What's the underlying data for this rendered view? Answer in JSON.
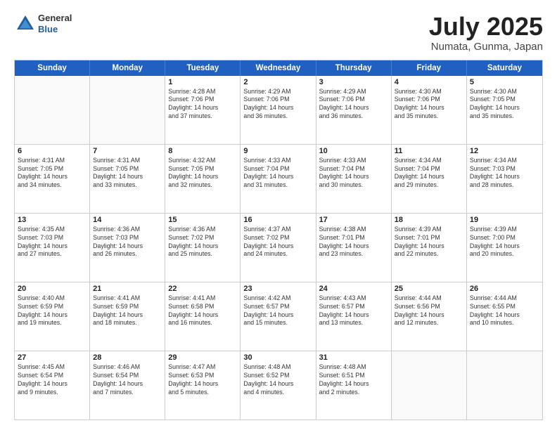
{
  "header": {
    "logo": {
      "general": "General",
      "blue": "Blue"
    },
    "title": "July 2025",
    "location": "Numata, Gunma, Japan"
  },
  "weekdays": [
    "Sunday",
    "Monday",
    "Tuesday",
    "Wednesday",
    "Thursday",
    "Friday",
    "Saturday"
  ],
  "weeks": [
    [
      {
        "day": "",
        "text": ""
      },
      {
        "day": "",
        "text": ""
      },
      {
        "day": "1",
        "text": "Sunrise: 4:28 AM\nSunset: 7:06 PM\nDaylight: 14 hours\nand 37 minutes."
      },
      {
        "day": "2",
        "text": "Sunrise: 4:29 AM\nSunset: 7:06 PM\nDaylight: 14 hours\nand 36 minutes."
      },
      {
        "day": "3",
        "text": "Sunrise: 4:29 AM\nSunset: 7:06 PM\nDaylight: 14 hours\nand 36 minutes."
      },
      {
        "day": "4",
        "text": "Sunrise: 4:30 AM\nSunset: 7:06 PM\nDaylight: 14 hours\nand 35 minutes."
      },
      {
        "day": "5",
        "text": "Sunrise: 4:30 AM\nSunset: 7:05 PM\nDaylight: 14 hours\nand 35 minutes."
      }
    ],
    [
      {
        "day": "6",
        "text": "Sunrise: 4:31 AM\nSunset: 7:05 PM\nDaylight: 14 hours\nand 34 minutes."
      },
      {
        "day": "7",
        "text": "Sunrise: 4:31 AM\nSunset: 7:05 PM\nDaylight: 14 hours\nand 33 minutes."
      },
      {
        "day": "8",
        "text": "Sunrise: 4:32 AM\nSunset: 7:05 PM\nDaylight: 14 hours\nand 32 minutes."
      },
      {
        "day": "9",
        "text": "Sunrise: 4:33 AM\nSunset: 7:04 PM\nDaylight: 14 hours\nand 31 minutes."
      },
      {
        "day": "10",
        "text": "Sunrise: 4:33 AM\nSunset: 7:04 PM\nDaylight: 14 hours\nand 30 minutes."
      },
      {
        "day": "11",
        "text": "Sunrise: 4:34 AM\nSunset: 7:04 PM\nDaylight: 14 hours\nand 29 minutes."
      },
      {
        "day": "12",
        "text": "Sunrise: 4:34 AM\nSunset: 7:03 PM\nDaylight: 14 hours\nand 28 minutes."
      }
    ],
    [
      {
        "day": "13",
        "text": "Sunrise: 4:35 AM\nSunset: 7:03 PM\nDaylight: 14 hours\nand 27 minutes."
      },
      {
        "day": "14",
        "text": "Sunrise: 4:36 AM\nSunset: 7:03 PM\nDaylight: 14 hours\nand 26 minutes."
      },
      {
        "day": "15",
        "text": "Sunrise: 4:36 AM\nSunset: 7:02 PM\nDaylight: 14 hours\nand 25 minutes."
      },
      {
        "day": "16",
        "text": "Sunrise: 4:37 AM\nSunset: 7:02 PM\nDaylight: 14 hours\nand 24 minutes."
      },
      {
        "day": "17",
        "text": "Sunrise: 4:38 AM\nSunset: 7:01 PM\nDaylight: 14 hours\nand 23 minutes."
      },
      {
        "day": "18",
        "text": "Sunrise: 4:39 AM\nSunset: 7:01 PM\nDaylight: 14 hours\nand 22 minutes."
      },
      {
        "day": "19",
        "text": "Sunrise: 4:39 AM\nSunset: 7:00 PM\nDaylight: 14 hours\nand 20 minutes."
      }
    ],
    [
      {
        "day": "20",
        "text": "Sunrise: 4:40 AM\nSunset: 6:59 PM\nDaylight: 14 hours\nand 19 minutes."
      },
      {
        "day": "21",
        "text": "Sunrise: 4:41 AM\nSunset: 6:59 PM\nDaylight: 14 hours\nand 18 minutes."
      },
      {
        "day": "22",
        "text": "Sunrise: 4:41 AM\nSunset: 6:58 PM\nDaylight: 14 hours\nand 16 minutes."
      },
      {
        "day": "23",
        "text": "Sunrise: 4:42 AM\nSunset: 6:57 PM\nDaylight: 14 hours\nand 15 minutes."
      },
      {
        "day": "24",
        "text": "Sunrise: 4:43 AM\nSunset: 6:57 PM\nDaylight: 14 hours\nand 13 minutes."
      },
      {
        "day": "25",
        "text": "Sunrise: 4:44 AM\nSunset: 6:56 PM\nDaylight: 14 hours\nand 12 minutes."
      },
      {
        "day": "26",
        "text": "Sunrise: 4:44 AM\nSunset: 6:55 PM\nDaylight: 14 hours\nand 10 minutes."
      }
    ],
    [
      {
        "day": "27",
        "text": "Sunrise: 4:45 AM\nSunset: 6:54 PM\nDaylight: 14 hours\nand 9 minutes."
      },
      {
        "day": "28",
        "text": "Sunrise: 4:46 AM\nSunset: 6:54 PM\nDaylight: 14 hours\nand 7 minutes."
      },
      {
        "day": "29",
        "text": "Sunrise: 4:47 AM\nSunset: 6:53 PM\nDaylight: 14 hours\nand 5 minutes."
      },
      {
        "day": "30",
        "text": "Sunrise: 4:48 AM\nSunset: 6:52 PM\nDaylight: 14 hours\nand 4 minutes."
      },
      {
        "day": "31",
        "text": "Sunrise: 4:48 AM\nSunset: 6:51 PM\nDaylight: 14 hours\nand 2 minutes."
      },
      {
        "day": "",
        "text": ""
      },
      {
        "day": "",
        "text": ""
      }
    ]
  ]
}
